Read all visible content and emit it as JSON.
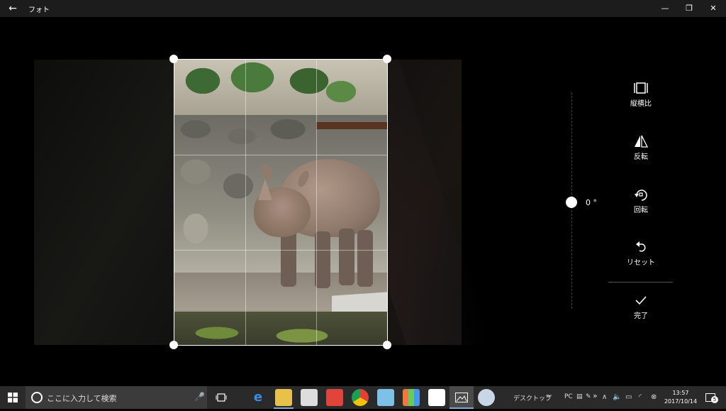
{
  "window": {
    "title": "フォト",
    "back_icon": "←",
    "minimize_icon": "—",
    "restore_icon": "❐",
    "close_icon": "✕"
  },
  "straighten": {
    "angle_label": "0 °",
    "angle_value": 0
  },
  "toolbar": {
    "aspect_ratio": "縦横比",
    "flip": "反転",
    "rotate": "回転",
    "reset": "リセット",
    "done": "完了"
  },
  "taskbar": {
    "search_placeholder": "ここに入力して検索",
    "desktop_label": "デスクトップ",
    "pc_label": "PC",
    "time": "13:57",
    "date": "2017/10/14",
    "notification_count": "5"
  },
  "colors": {
    "accent": "#7aa8d8",
    "titlebar": "#1c1c1c",
    "taskbar": "#2a2a2a"
  }
}
